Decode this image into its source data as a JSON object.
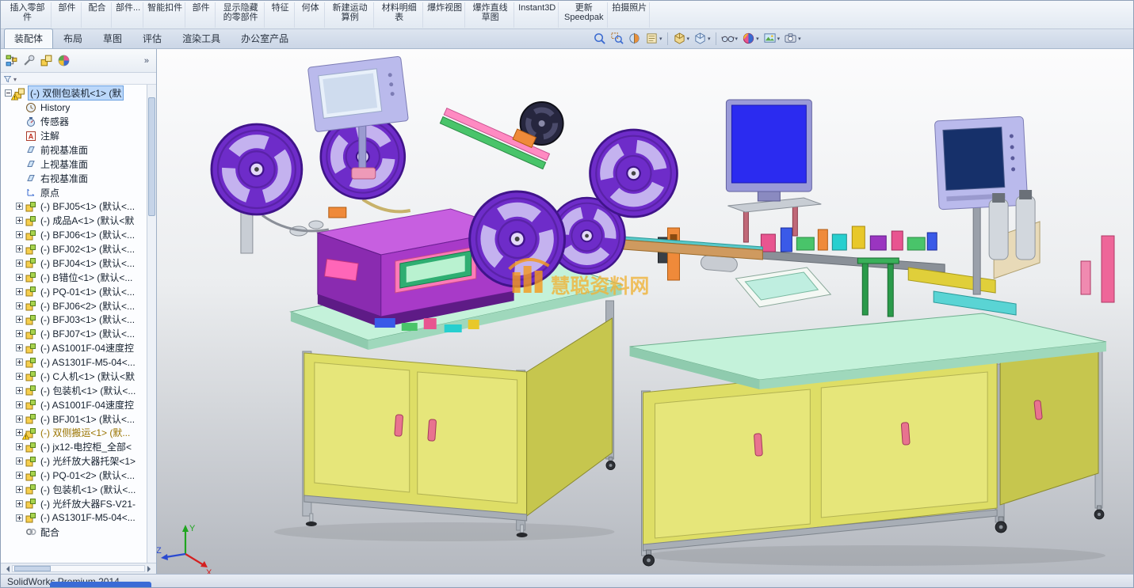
{
  "ribbon": {
    "items": [
      {
        "label": "插入零部件"
      },
      {
        "label": "部件"
      },
      {
        "label": "配合"
      },
      {
        "label": "部件..."
      },
      {
        "label": "智能扣件"
      },
      {
        "label": "部件"
      },
      {
        "label": "显示隐藏的零部件"
      },
      {
        "label": "特征"
      },
      {
        "label": "何体"
      },
      {
        "label": "新建运动算例"
      },
      {
        "label": "材料明细表"
      },
      {
        "label": "爆炸视图"
      },
      {
        "label": "爆炸直线草图"
      },
      {
        "label": "Instant3D"
      },
      {
        "label": "更新Speedpak"
      },
      {
        "label": "拍摄照片"
      }
    ]
  },
  "tabs": {
    "items": [
      "装配体",
      "布局",
      "草图",
      "评估",
      "渲染工具",
      "办公室产品"
    ],
    "active": 0
  },
  "view_toolbar": {
    "icons": [
      {
        "name": "zoom-to-fit-icon",
        "glyph": "zoomfit",
        "dropdown": false,
        "sep": false
      },
      {
        "name": "zoom-to-area-icon",
        "glyph": "zoomarea",
        "dropdown": false,
        "sep": false
      },
      {
        "name": "section-view-icon",
        "glyph": "section",
        "dropdown": false,
        "sep": false
      },
      {
        "name": "annotation-views-icon",
        "glyph": "book",
        "dropdown": true,
        "sep": false
      },
      {
        "name": "view-orientation-icon",
        "glyph": "vieworient",
        "dropdown": true,
        "sep": true
      },
      {
        "name": "display-style-icon",
        "glyph": "dispstyle",
        "dropdown": true,
        "sep": false
      },
      {
        "name": "hide-show-items-icon",
        "glyph": "glasses",
        "dropdown": true,
        "sep": true
      },
      {
        "name": "edit-appearance-icon",
        "glyph": "appearance",
        "dropdown": true,
        "sep": false
      },
      {
        "name": "apply-scene-icon",
        "glyph": "scene",
        "dropdown": true,
        "sep": false
      },
      {
        "name": "view-settings-icon",
        "glyph": "camera",
        "dropdown": true,
        "sep": false
      }
    ]
  },
  "panel_toolbar": {
    "icons": [
      {
        "name": "featuremanager-tree-icon",
        "glyph": "fmtree"
      },
      {
        "name": "propertymanager-icon",
        "glyph": "propmgr"
      },
      {
        "name": "configurationmanager-icon",
        "glyph": "configmgr"
      },
      {
        "name": "displaymanager-icon",
        "glyph": "dispmgr"
      }
    ],
    "overflow": "»"
  },
  "tree": {
    "items": [
      {
        "label": "(-) 双侧包装机<1> (默",
        "icon": "assembly",
        "expander": "minus",
        "indent": 0,
        "selected": true,
        "warning": true
      },
      {
        "label": "History",
        "icon": "history",
        "indent": 1
      },
      {
        "label": "传感器",
        "icon": "sensors",
        "indent": 1
      },
      {
        "label": "注解",
        "icon": "annotations",
        "indent": 1
      },
      {
        "label": "前视基准面",
        "icon": "plane",
        "indent": 1
      },
      {
        "label": "上视基准面",
        "icon": "plane",
        "indent": 1
      },
      {
        "label": "右视基准面",
        "icon": "plane",
        "indent": 1
      },
      {
        "label": "原点",
        "icon": "origin",
        "indent": 1
      },
      {
        "label": "(-) BFJ05<1> (默认<...",
        "icon": "component",
        "expander": "plus",
        "indent": 1
      },
      {
        "label": "(-) 成品A<1> (默认<默",
        "icon": "component",
        "expander": "plus",
        "indent": 1
      },
      {
        "label": "(-) BFJ06<1> (默认<...",
        "icon": "component",
        "expander": "plus",
        "indent": 1
      },
      {
        "label": "(-) BFJ02<1> (默认<...",
        "icon": "component",
        "expander": "plus",
        "indent": 1
      },
      {
        "label": "(-) BFJ04<1> (默认<...",
        "icon": "component",
        "expander": "plus",
        "indent": 1
      },
      {
        "label": "(-) B错位<1> (默认<...",
        "icon": "component",
        "expander": "plus",
        "indent": 1
      },
      {
        "label": "(-) PQ-01<1> (默认<...",
        "icon": "component",
        "expander": "plus",
        "indent": 1
      },
      {
        "label": "(-) BFJ06<2> (默认<...",
        "icon": "component",
        "expander": "plus",
        "indent": 1
      },
      {
        "label": "(-) BFJ03<1> (默认<...",
        "icon": "component",
        "expander": "plus",
        "indent": 1
      },
      {
        "label": "(-) BFJ07<1> (默认<...",
        "icon": "component",
        "expander": "plus",
        "indent": 1
      },
      {
        "label": "(-) AS1001F-04速度控",
        "icon": "component",
        "expander": "plus",
        "indent": 1
      },
      {
        "label": "(-) AS1301F-M5-04<...",
        "icon": "component",
        "expander": "plus",
        "indent": 1
      },
      {
        "label": "(-) C人机<1> (默认<默",
        "icon": "component",
        "expander": "plus",
        "indent": 1
      },
      {
        "label": "(-) 包装机<1> (默认<...",
        "icon": "component",
        "expander": "plus",
        "indent": 1
      },
      {
        "label": "(-) AS1001F-04速度控",
        "icon": "component",
        "expander": "plus",
        "indent": 1
      },
      {
        "label": "(-) BFJ01<1> (默认<...",
        "icon": "component",
        "expander": "plus",
        "indent": 1
      },
      {
        "label": "(-) 双侧搬运<1> (默...",
        "icon": "component",
        "expander": "plus",
        "indent": 1,
        "warning": true,
        "warn_text": true
      },
      {
        "label": "(-) jx12-电控柜_全部<",
        "icon": "component",
        "expander": "plus",
        "indent": 1
      },
      {
        "label": "(-) 光纤放大器托架<1>",
        "icon": "component",
        "expander": "plus",
        "indent": 1
      },
      {
        "label": "(-) PQ-01<2> (默认<...",
        "icon": "component",
        "expander": "plus",
        "indent": 1
      },
      {
        "label": "(-) 包装机<1> (默认<...",
        "icon": "component",
        "expander": "plus",
        "indent": 1
      },
      {
        "label": "(-) 光纤放大器FS-V21-",
        "icon": "component",
        "expander": "plus",
        "indent": 1
      },
      {
        "label": "(-) AS1301F-M5-04<...",
        "icon": "component",
        "expander": "plus",
        "indent": 1
      },
      {
        "label": "配合",
        "icon": "mates",
        "indent": 1
      }
    ]
  },
  "viewport": {
    "watermark": "慧聪资料网",
    "triad": {
      "x": "X",
      "y": "Y",
      "z": "Z"
    }
  },
  "statusbar": {
    "text": "SolidWorks Premium 2014"
  }
}
